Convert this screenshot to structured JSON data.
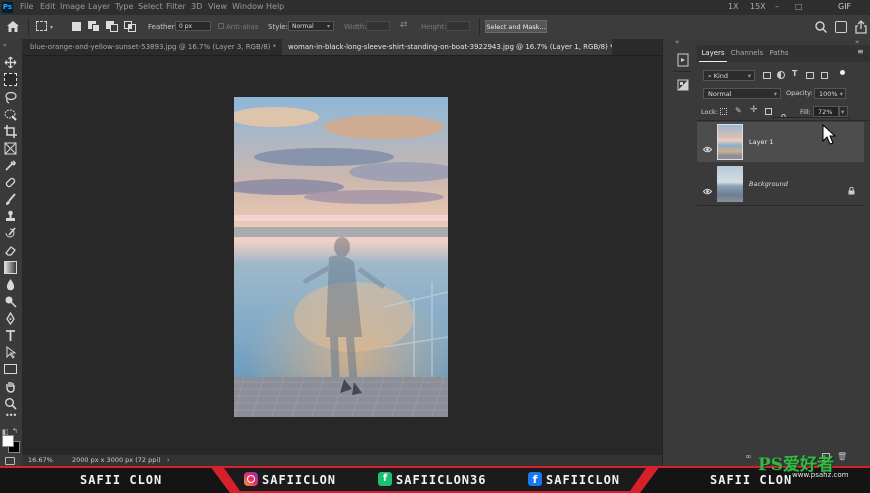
{
  "menubar": {
    "app_badge": "Ps",
    "items": [
      "File",
      "Edit",
      "Image",
      "Layer",
      "Type",
      "Select",
      "Filter",
      "3D",
      "View",
      "Window",
      "Help"
    ],
    "window_controls": [
      "1X",
      "15X",
      "–",
      "□",
      "GIF"
    ]
  },
  "options": {
    "feather_label": "Feather:",
    "feather_value": "0 px",
    "antialias_label": "Anti-alias",
    "style_label": "Style:",
    "style_value": "Normal",
    "width_label": "Width:",
    "height_label": "Height:",
    "select_mask_label": "Select and Mask..."
  },
  "tabs": [
    {
      "label": "blue-orange-and-yellow-sunset-53893.jpg @ 16.7% (Layer 3, RGB/8) *",
      "close": "×"
    },
    {
      "label": "woman-in-black-long-sleeve-shirt-standing-on-boat-3922943.jpg @ 16.7% (Layer 1, RGB/8) *",
      "close": "×"
    }
  ],
  "status": {
    "zoom": "16.67%",
    "doc_size": "2000 px x 3000 px (72 ppi)",
    "arrow": "›"
  },
  "panel": {
    "tabs": [
      "Layers",
      "Channels",
      "Paths"
    ],
    "kind_label": "Kind",
    "blend_mode": "Normal",
    "opacity_label": "Opacity:",
    "opacity_value": "100%",
    "lock_label": "Lock:",
    "fill_label": "Fill:",
    "fill_value": "72%",
    "fill_slider_fraction": 0.72,
    "layers": [
      {
        "name": "Layer 1",
        "selected": true
      },
      {
        "name": "Background",
        "selected": false,
        "locked": true
      }
    ]
  },
  "banner": {
    "name_left": "SAFII CLON",
    "instagram": "SAFIICLON",
    "fiverr": "SAFIICLON36",
    "facebook": "SAFIICLON",
    "name_right": "SAFII CLON",
    "watermark_brand": "PS爱好者",
    "watermark_url": "www.psahz.com"
  },
  "colors": {
    "accent": "#31a8ff",
    "banner_red": "#d8202a",
    "banner_bg": "#141414"
  }
}
